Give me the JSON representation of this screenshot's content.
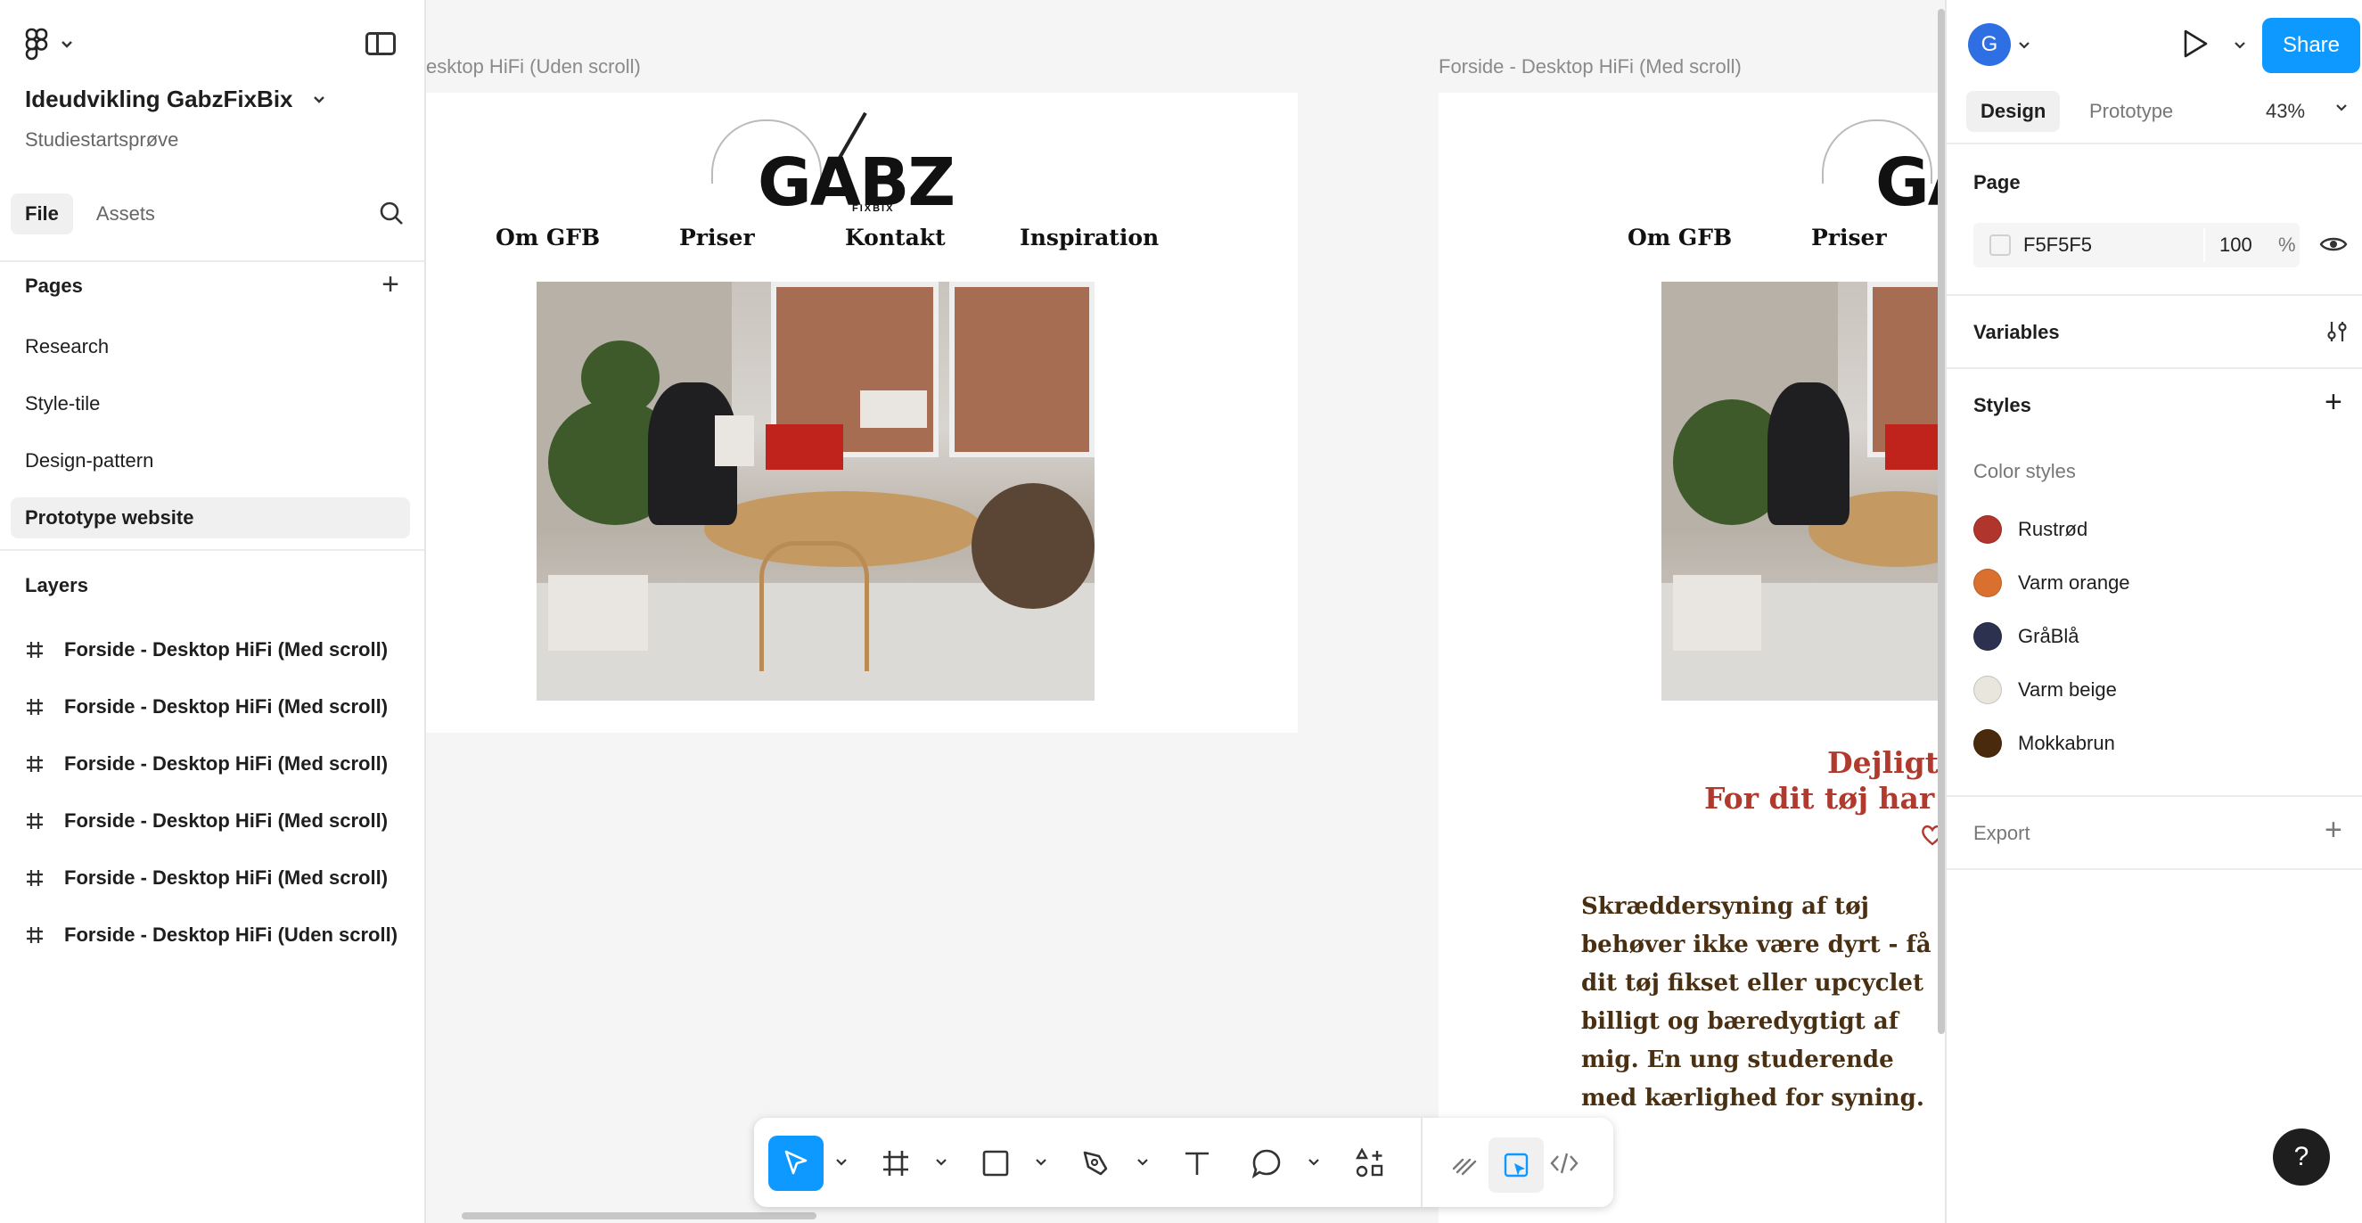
{
  "left_panel": {
    "file_name": "Ideudvikling GabzFixBix",
    "project": "Studiestartsprøve",
    "tabs": [
      "File",
      "Assets"
    ],
    "pages_title": "Pages",
    "pages": [
      "Research",
      "Style-tile",
      "Design-pattern",
      "Prototype website"
    ],
    "active_page": "Prototype website",
    "layers_title": "Layers",
    "layers": [
      "Forside - Desktop HiFi (Med scroll)",
      "Forside - Desktop HiFi (Med scroll)",
      "Forside - Desktop HiFi (Med scroll)",
      "Forside - Desktop HiFi (Med scroll)",
      "Forside - Desktop HiFi (Med scroll)",
      "Forside - Desktop HiFi (Uden scroll)"
    ]
  },
  "canvas": {
    "frame1_label": "esktop HiFi (Uden scroll)",
    "frame2_label": "Forside - Desktop HiFi (Med scroll)",
    "brand": "GABZ",
    "brand_sub": "FIXBIX",
    "brand_cropped": "GA",
    "nav": [
      "Om GFB",
      "Priser",
      "Kontakt",
      "Inspiration"
    ],
    "headline_1": "Dejligt d",
    "headline_2": "For dit tøj har så",
    "body": "Skræddersyning af tøj behøver ikke være dyrt - få dit tøj fikset eller upcyclet billigt og bæredygtigt af mig. En ung studerende med kærlighed for syning."
  },
  "toolbar": {
    "tools": [
      "move-tool",
      "frame-tool",
      "rectangle-tool",
      "pen-tool",
      "text-tool",
      "comment-tool",
      "actions-tool",
      "draw-mode",
      "design-mode",
      "dev-mode"
    ]
  },
  "right_panel": {
    "avatar_initial": "G",
    "share_label": "Share",
    "tabs": [
      "Design",
      "Prototype"
    ],
    "zoom": "43%",
    "page_title": "Page",
    "page_fill_hex": "F5F5F5",
    "page_fill_opacity": "100",
    "page_fill_unit": "%",
    "variables_title": "Variables",
    "styles_title": "Styles",
    "color_styles_title": "Color styles",
    "color_styles": [
      {
        "name": "Rustrød",
        "color": "#b0352c"
      },
      {
        "name": "Varm orange",
        "color": "#d9702f"
      },
      {
        "name": "GråBlå",
        "color": "#2c3150"
      },
      {
        "name": "Varm beige",
        "color": "#e9e6dd"
      },
      {
        "name": "Mokkabrun",
        "color": "#4a2a0c"
      }
    ],
    "export_title": "Export",
    "help": "?"
  }
}
